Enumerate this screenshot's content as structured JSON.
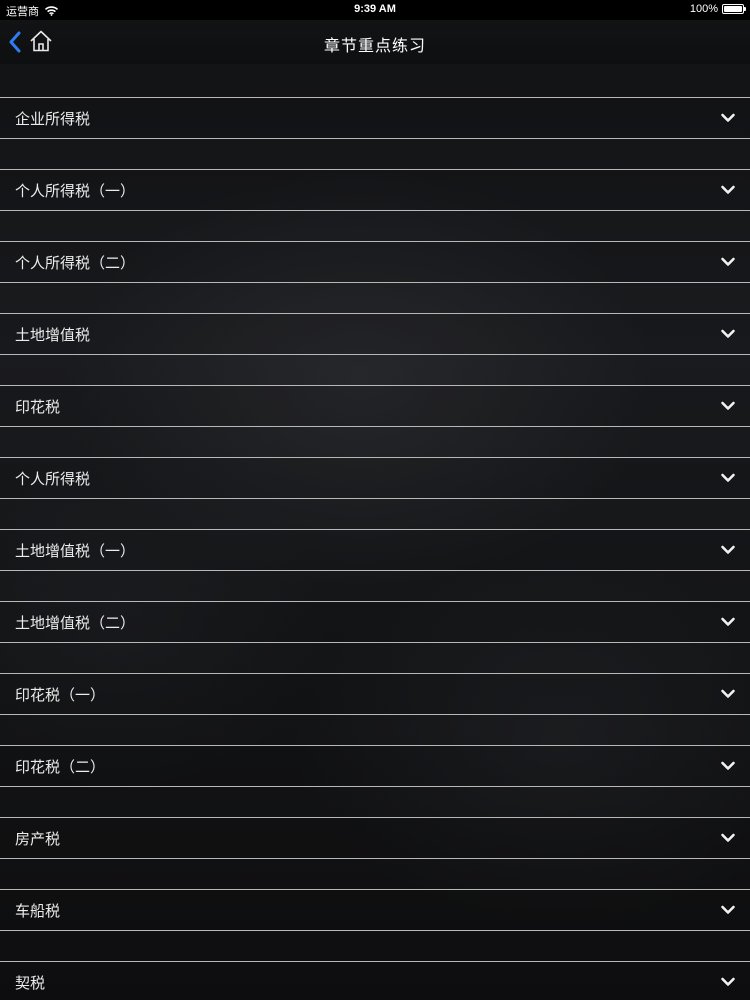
{
  "status_bar": {
    "carrier": "运营商",
    "time": "9:39 AM",
    "battery": "100%"
  },
  "nav": {
    "title": "章节重点练习",
    "back_icon": "chevron-left-icon",
    "home_icon": "home-icon",
    "accent": "#2f7df6"
  },
  "sections": [
    {
      "label": "企业所得税"
    },
    {
      "label": "个人所得税（一）"
    },
    {
      "label": "个人所得税（二）"
    },
    {
      "label": "土地增值税"
    },
    {
      "label": "印花税"
    },
    {
      "label": "个人所得税"
    },
    {
      "label": "土地增值税（一）"
    },
    {
      "label": "土地增值税（二）"
    },
    {
      "label": "印花税（一）"
    },
    {
      "label": "印花税（二）"
    },
    {
      "label": "房产税"
    },
    {
      "label": "车船税"
    },
    {
      "label": "契税"
    }
  ]
}
